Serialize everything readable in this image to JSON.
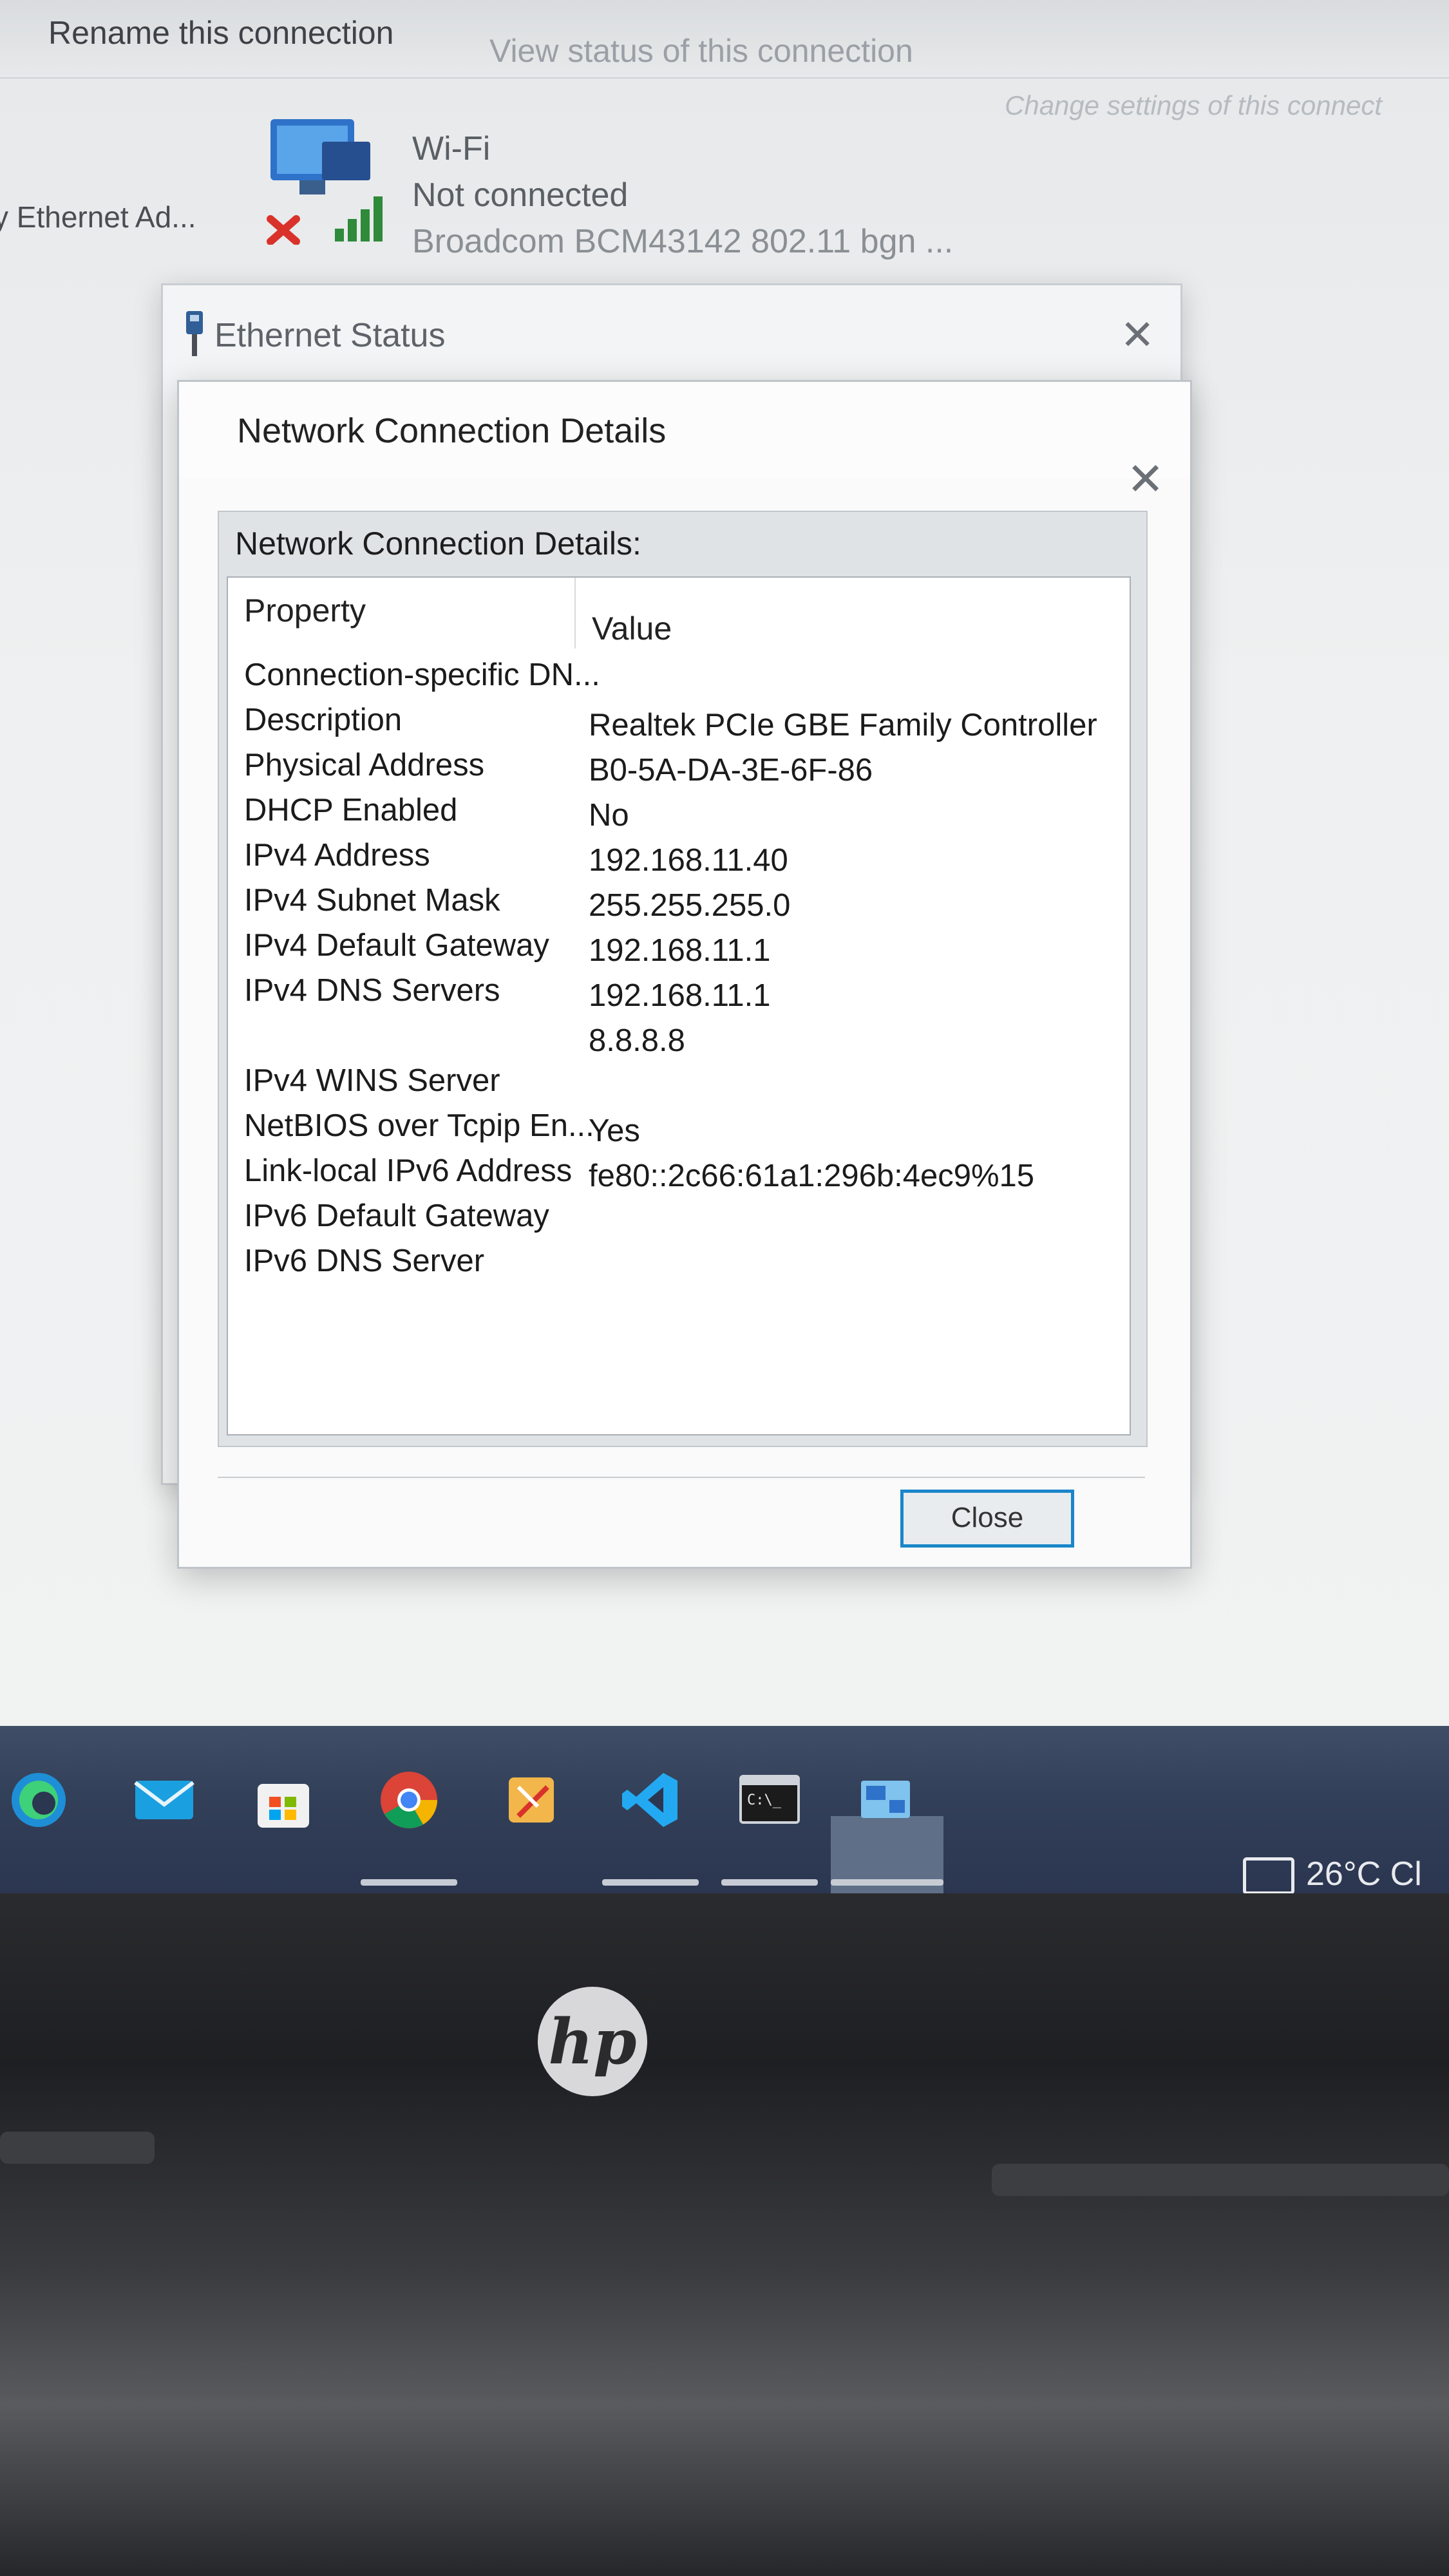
{
  "command_bar": {
    "rename": "Rename this connection",
    "view_status": "View status of this connection",
    "change_settings": "Change settings of this connect"
  },
  "adapters": {
    "ethernet_label": "y Ethernet Ad...",
    "wifi": {
      "name": "Wi-Fi",
      "status": "Not connected",
      "device": "Broadcom BCM43142 802.11 bgn ..."
    }
  },
  "ethernet_status": {
    "title": "Ethernet Status",
    "close": "✕"
  },
  "details_dialog": {
    "title": "Network Connection Details",
    "close": "✕",
    "group_label": "Network Connection Details:",
    "columns": {
      "property": "Property",
      "value": "Value"
    },
    "rows": [
      {
        "property": "Connection-specific DN...",
        "value": ""
      },
      {
        "property": "Description",
        "value": "Realtek PCIe GBE Family Controller"
      },
      {
        "property": "Physical Address",
        "value": "B0-5A-DA-3E-6F-86"
      },
      {
        "property": "DHCP Enabled",
        "value": "No"
      },
      {
        "property": "IPv4 Address",
        "value": "192.168.11.40"
      },
      {
        "property": "IPv4 Subnet Mask",
        "value": "255.255.255.0"
      },
      {
        "property": "IPv4 Default Gateway",
        "value": "192.168.11.1"
      },
      {
        "property": "IPv4 DNS Servers",
        "value": "192.168.11.1"
      },
      {
        "property": "",
        "value": "8.8.8.8"
      },
      {
        "property": "IPv4 WINS Server",
        "value": ""
      },
      {
        "property": "NetBIOS over Tcpip En...",
        "value": "Yes"
      },
      {
        "property": "Link-local IPv6 Address",
        "value": "fe80::2c66:61a1:296b:4ec9%15"
      },
      {
        "property": "IPv6 Default Gateway",
        "value": ""
      },
      {
        "property": "IPv6 DNS Server",
        "value": ""
      }
    ],
    "close_button": "Close"
  },
  "taskbar": {
    "icons": [
      "edge-icon",
      "mail-icon",
      "store-icon",
      "chrome-icon",
      "snip-sketch-icon",
      "vscode-icon",
      "terminal-icon",
      "network-settings-icon"
    ],
    "tray_temperature": "26°C Cl"
  },
  "hardware": {
    "logo": "hp"
  },
  "colors": {
    "accent": "#1a86c9",
    "taskbar": "#33405a",
    "error_red": "#d9322b"
  }
}
